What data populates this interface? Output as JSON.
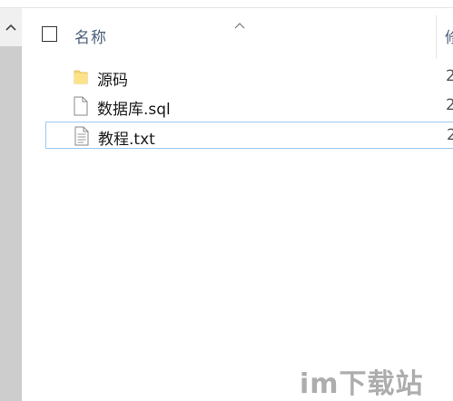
{
  "header": {
    "name_label": "名称",
    "modified_label": "修"
  },
  "files": [
    {
      "name": "源码",
      "type": "folder",
      "date_prefix": "2"
    },
    {
      "name": "数据库.sql",
      "type": "file",
      "date_prefix": "2"
    },
    {
      "name": "教程.txt",
      "type": "text-file",
      "date_prefix": "2"
    }
  ],
  "watermark": {
    "text": "im下载站"
  },
  "colors": {
    "header_text": "#4c607a",
    "focus_border": "#99c9ef",
    "folder_yellow": "#f8d775"
  }
}
